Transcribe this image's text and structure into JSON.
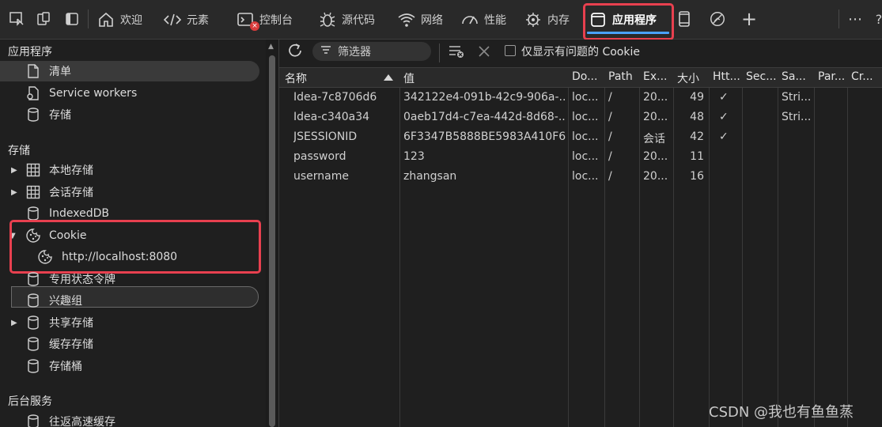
{
  "toolbar": {
    "tabs": [
      {
        "label": "欢迎",
        "icon": "home-icon"
      },
      {
        "label": "元素",
        "icon": "code-icon"
      },
      {
        "label": "控制台",
        "icon": "console-icon"
      },
      {
        "label": "源代码",
        "icon": "bug-icon"
      },
      {
        "label": "网络",
        "icon": "wifi-icon"
      },
      {
        "label": "性能",
        "icon": "gauge-icon"
      },
      {
        "label": "内存",
        "icon": "chip-icon"
      },
      {
        "label": "应用程序",
        "icon": "window-icon",
        "active": true
      }
    ],
    "more": "⋯",
    "help": "?",
    "add": "+",
    "error_badge": "×"
  },
  "sidebar": {
    "sections": [
      {
        "title": "应用程序",
        "items": [
          "清单",
          "Service workers",
          "存储"
        ]
      },
      {
        "title": "存储",
        "items": [
          "本地存储",
          "会话存储",
          "IndexedDB",
          "Cookie",
          "http://localhost:8080",
          "专用状态令牌",
          "兴趣组",
          "共享存储",
          "缓存存储",
          "存储桶"
        ]
      },
      {
        "title": "后台服务",
        "items": [
          "往返高速缓存"
        ]
      }
    ]
  },
  "controls": {
    "filter_placeholder": "筛选器",
    "only_issues_label": "仅显示有问题的 Cookie"
  },
  "table": {
    "columns": [
      "名称",
      "值",
      "Do...",
      "Path",
      "Ex...",
      "大小",
      "Htt...",
      "Sec...",
      "Sa...",
      "Par...",
      "Cr..."
    ],
    "rows": [
      [
        "Idea-7c8706d6",
        "342122e4-091b-42c9-906a-...",
        "loc...",
        "/",
        "20...",
        "49",
        "✓",
        "",
        "Stri...",
        "",
        ""
      ],
      [
        "Idea-c340a34",
        "0aeb17d4-c7ea-442d-8d68-...",
        "loc...",
        "/",
        "20...",
        "48",
        "✓",
        "",
        "Stri...",
        "",
        ""
      ],
      [
        "JSESSIONID",
        "6F3347B5888BE5983A410F6...",
        "loc...",
        "/",
        "会话",
        "42",
        "✓",
        "",
        "",
        "",
        ""
      ],
      [
        "password",
        "123",
        "loc...",
        "/",
        "20...",
        "11",
        "",
        "",
        "",
        "",
        ""
      ],
      [
        "username",
        "zhangsan",
        "loc...",
        "/",
        "20...",
        "16",
        "",
        "",
        "",
        "",
        ""
      ]
    ]
  },
  "watermark": "CSDN @我也有鱼鱼蒸",
  "colors": {
    "accent": "#4aa3ff",
    "highlight": "#e8404f",
    "background": "#1f1f1f",
    "toolbar": "#292929"
  }
}
